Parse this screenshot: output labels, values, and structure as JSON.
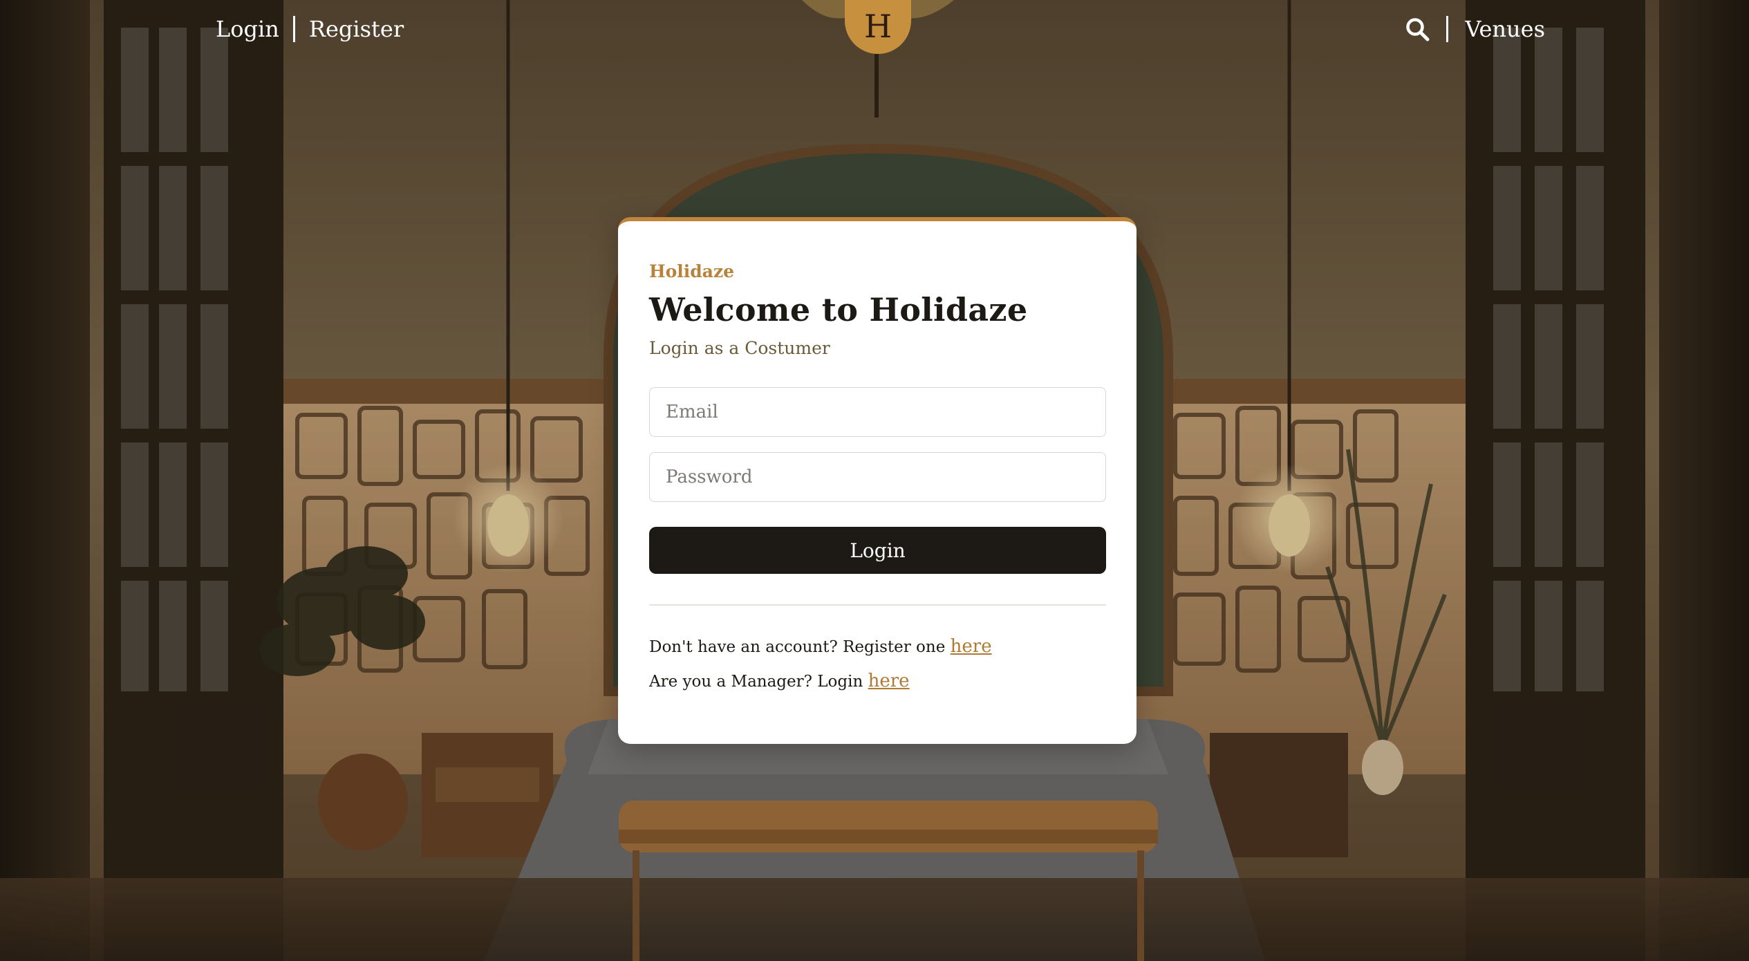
{
  "header": {
    "login_label": "Login",
    "register_label": "Register",
    "logo_letter": "H",
    "venues_label": "Venues",
    "search_icon": "search-icon"
  },
  "card": {
    "brand": "Holidaze",
    "title": "Welcome to Holidaze",
    "subtitle": "Login as a Costumer",
    "email_placeholder": "Email",
    "email_value": "",
    "password_placeholder": "Password",
    "password_value": "",
    "login_button": "Login",
    "register_prompt": "Don't have an account? Register one",
    "register_link": "here",
    "manager_prompt": "Are you a Manager? Login",
    "manager_link": "here"
  },
  "colors": {
    "accent": "#c0853a",
    "button_bg": "#1d1a16",
    "logo_bg": "#c6903f"
  }
}
